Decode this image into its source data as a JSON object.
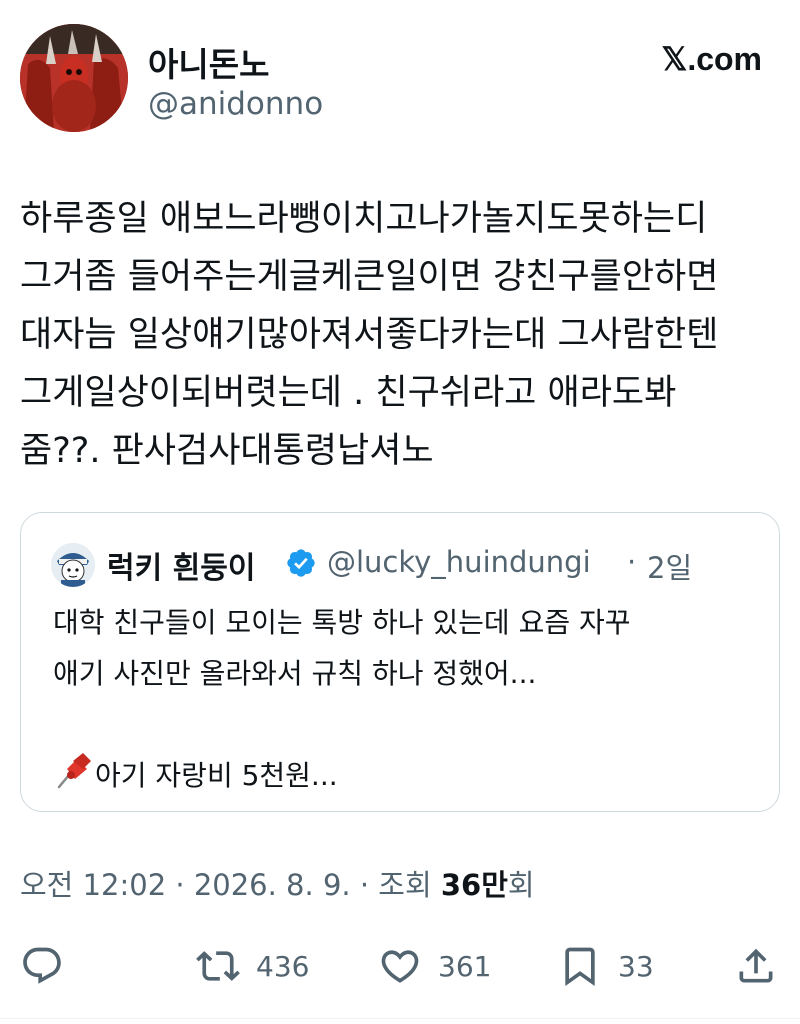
{
  "author": {
    "display_name": "아니돈노",
    "handle": "@anidonno"
  },
  "brand": "𝕏.com",
  "tweet_lines": [
    "하루종일 애보느라뺑이치고나가놀지도못하는디",
    "그거좀 들어주는게글케큰일이면 걍친구를안하면",
    "대자늠 일상얘기많아져서좋다카는대 그사람한텐",
    "그게일상이되버렷는데 . 친구쉬라고 애라도봐",
    "줌??. 판사검사대통령납셔노"
  ],
  "quote": {
    "display_name": "럭키 흰둥이",
    "handle": "@lucky_huindungi",
    "separator": "·",
    "time": "2일",
    "lines": [
      "대학 친구들이 모이는 톡방 하나 있는데 요즘 자꾸",
      "애기 사진만 올라와서 규칙 하나 정했어...",
      "",
      "아기 자랑비 5천원..."
    ],
    "pin_icon": "pushpin-icon",
    "verified_color": "#1d9bf0"
  },
  "meta": {
    "time": "오전 12:02",
    "sep1": " · ",
    "date": "2026. 8. 9.",
    "sep2": " · ",
    "views_prefix": "조회 ",
    "views_value": "36만",
    "views_suffix": "회"
  },
  "actions": {
    "reply_icon": "reply-icon",
    "retweet_icon": "retweet-icon",
    "retweet_count": "436",
    "like_icon": "heart-icon",
    "like_count": "361",
    "bookmark_icon": "bookmark-icon",
    "bookmark_count": "33",
    "share_icon": "share-icon"
  },
  "colors": {
    "text": "#0f1419",
    "secondary": "#536471",
    "border": "#cfd9de",
    "verified": "#1d9bf0"
  }
}
